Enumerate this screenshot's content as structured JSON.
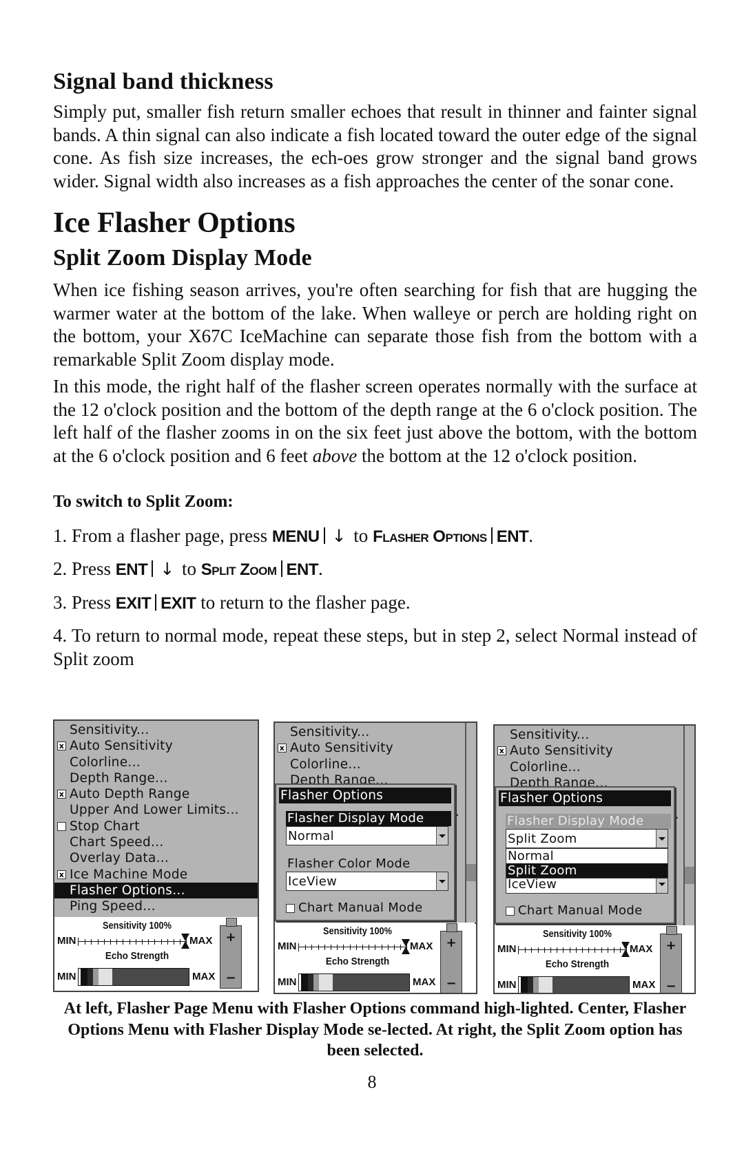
{
  "sections": {
    "signal_band": {
      "heading": "Signal band thickness",
      "body": "Simply put, smaller fish return smaller echoes that result in thinner and fainter signal bands. A thin signal can also indicate a fish located toward the outer edge of the signal cone. As fish size increases, the ech-oes grow stronger and the signal band grows wider. Signal width also increases as a fish approaches the center of the sonar cone."
    },
    "ice_flasher": {
      "heading": "Ice Flasher Options"
    },
    "split_zoom": {
      "heading": "Split Zoom Display Mode",
      "para1": "When ice fishing season arrives, you're often searching for fish that are hugging the warmer water at the bottom of the lake. When walleye or perch are holding right on the bottom, your X67C IceMachine can separate those fish from the bottom with a remarkable Split Zoom display mode.",
      "para2_a": "In this mode, the right half of the flasher screen operates normally with the surface at the 12 o'clock position and the bottom of the depth range at the 6 o'clock position. The left half of the flasher zooms in on the six feet just above the bottom, with the bottom at the 6 o'clock position and 6 feet ",
      "para2_em": "above",
      "para2_b": " the bottom at the 12 o'clock position.",
      "instructions_heading": "To switch to Split Zoom:"
    }
  },
  "steps": {
    "s1": {
      "prefix": "1. From a flasher page, press ",
      "key1": "MENU",
      "arrow": "↓",
      "to": " to ",
      "cmd_big1": "F",
      "cmd_small1": "LASHER",
      "cmd_big2": " O",
      "cmd_small2": "PTIONS",
      "key2": "ENT",
      "end": "."
    },
    "s2": {
      "prefix": "2. Press ",
      "key1": "ENT",
      "arrow": "↓",
      "to": " to ",
      "cmd_big1": "S",
      "cmd_small1": "PLIT",
      "cmd_big2": " Z",
      "cmd_small2": "OOM",
      "key2": "ENT",
      "end": "."
    },
    "s3": {
      "prefix": "3. Press ",
      "key1": "EXIT",
      "key2": "EXIT",
      "suffix": " to return to the flasher page."
    },
    "s4": {
      "text": "4. To return to normal mode, repeat these steps, but in step 2, select Normal instead of Split zoom"
    }
  },
  "screens": {
    "menu_items": [
      {
        "label": "Sensitivity...",
        "checkbox": null
      },
      {
        "label": "Auto Sensitivity",
        "checkbox": "checked"
      },
      {
        "label": "Colorline...",
        "checkbox": null
      },
      {
        "label": "Depth Range...",
        "checkbox": null
      },
      {
        "label": "Auto Depth Range",
        "checkbox": "checked"
      },
      {
        "label": "Upper And Lower Limits...",
        "checkbox": null
      },
      {
        "label": "Stop Chart",
        "checkbox": "unchecked"
      },
      {
        "label": "Chart Speed...",
        "checkbox": null
      },
      {
        "label": "Overlay Data...",
        "checkbox": null
      },
      {
        "label": "Ice Machine Mode",
        "checkbox": "checked"
      },
      {
        "label": "Flasher Options...",
        "checkbox": null,
        "selected": true
      },
      {
        "label": "Ping Speed...",
        "checkbox": null
      }
    ],
    "check_glyph": "x",
    "status": {
      "sensitivity_label": "Sensitivity 100%",
      "sensitivity_value_pct": 100,
      "min_label": "MIN",
      "max_label": "MAX",
      "echo_label": "Echo Strength",
      "battery_plus": "+",
      "battery_minus": "−"
    },
    "flasher_options": {
      "title": "Flasher Options",
      "display_mode_label": "Flasher Display Mode",
      "display_mode_center": "Normal",
      "display_mode_right": "Split Zoom",
      "color_mode_label": "Flasher Color Mode",
      "color_mode_value": "IceView",
      "chart_manual_label": "Chart Manual Mode",
      "list_options": [
        "Normal",
        "Split Zoom"
      ],
      "list_selected": "Split Zoom"
    }
  },
  "caption": "At left, Flasher Page Menu with Flasher Options command high-lighted. Center, Flasher Options Menu with Flasher Display Mode se-lected. At right, the Split Zoom option has been selected.",
  "page_number": "8"
}
